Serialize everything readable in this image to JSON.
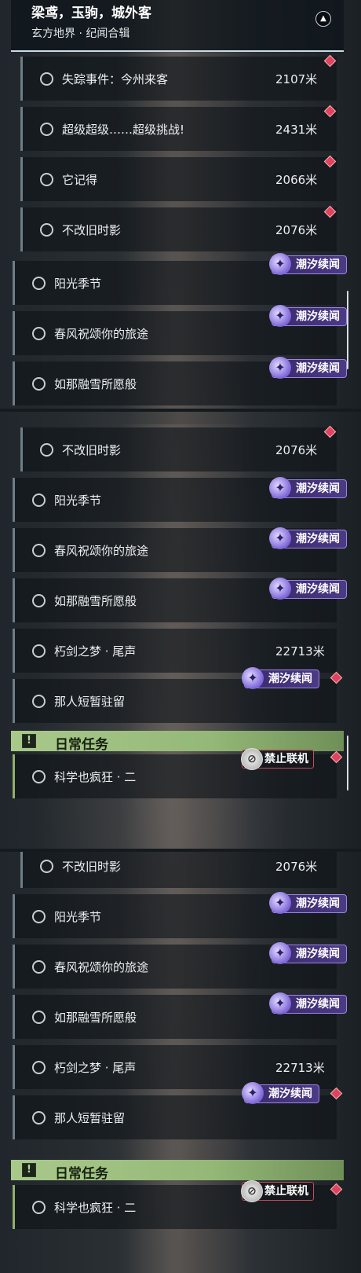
{
  "header": {
    "title": "梁鸢，玉驹，城外客",
    "subtitle": "玄方地界 · 纪闻合辑"
  },
  "badges": {
    "tide": "潮汐续闻",
    "no_online": "禁止联机"
  },
  "daily_label": "日常任务",
  "quests": {
    "missing": {
      "label": "失踪事件：今州来客",
      "distance": "2107米"
    },
    "super": {
      "label": "超级超级……超级挑战!",
      "distance": "2431米"
    },
    "remember": {
      "label": "它记得",
      "distance": "2066米"
    },
    "shadow": {
      "label": "不改旧时影",
      "distance": "2076米"
    },
    "sunshine": {
      "label": "阳光季节"
    },
    "spring": {
      "label": "春风祝颂你的旅途"
    },
    "snow": {
      "label": "如那融雪所愿般"
    },
    "sword": {
      "label": "朽剑之梦 · 尾声",
      "distance": "22713米"
    },
    "stay": {
      "label": "那人短暂驻留"
    },
    "science": {
      "label": "科学也疯狂 · 二"
    }
  },
  "colors": {
    "accent_green": "#a9c98b",
    "badge_purple": "#4b3a86",
    "marker_red": "#e0435b"
  },
  "icons": {
    "collapse": "chevron-up-icon",
    "tide_badge": "tide-swirl-icon",
    "ban": "no-online-icon",
    "daily": "exclamation-icon"
  }
}
